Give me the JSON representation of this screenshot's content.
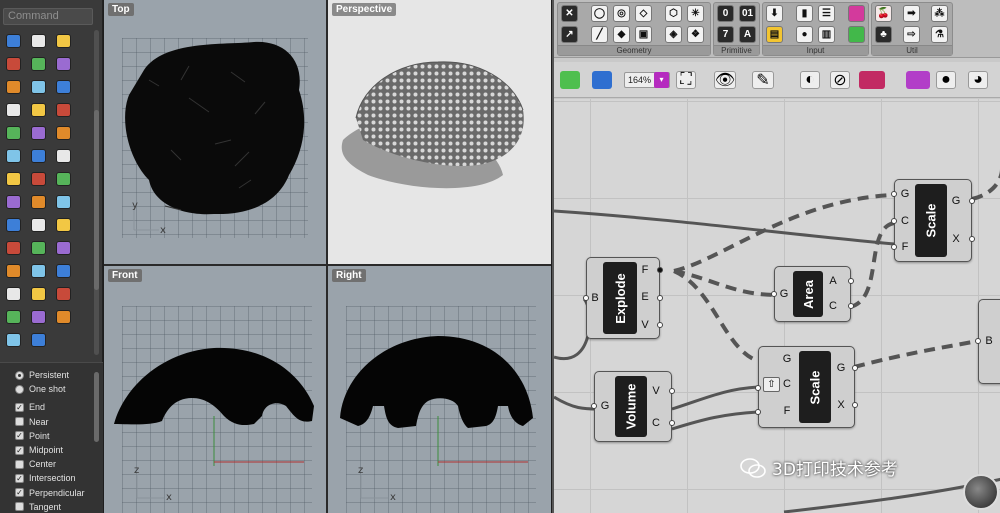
{
  "rhino": {
    "command_placeholder": "Command",
    "tools": [
      "box-icon",
      "sphere-icon",
      "cylinder-icon",
      "plane-icon",
      "move-icon",
      "curve-icon",
      "sweep-icon",
      "polyline-icon",
      "point-icon",
      "align-icon",
      "rotate-icon",
      "arc-icon",
      "text-icon",
      "scale-icon",
      "array-icon",
      "mirror-icon",
      "box3d-icon",
      "hatch-icon",
      "grid-icon",
      "split-icon",
      "paint-icon",
      "check-icon",
      "eraser-icon",
      "bucket-icon",
      "zoom-icon",
      "zoom-window-icon",
      "zoom-extents-icon",
      "zoom-in-icon",
      "zoom-out-icon",
      "measure-icon",
      "layer-icon",
      "shade-icon",
      "light-icon",
      "lock-icon",
      "render-icon",
      "color-wheel-icon",
      "globe-icon",
      "wire-sphere-icon",
      "viewport-icon",
      "pen-icon",
      "snap-tree-icon"
    ],
    "snap": {
      "persistent": "Persistent",
      "one_shot": "One shot",
      "items": [
        {
          "label": "End",
          "checked": true
        },
        {
          "label": "Near",
          "checked": false
        },
        {
          "label": "Point",
          "checked": true
        },
        {
          "label": "Midpoint",
          "checked": true
        },
        {
          "label": "Center",
          "checked": false
        },
        {
          "label": "Intersection",
          "checked": true
        },
        {
          "label": "Perpendicular",
          "checked": true
        },
        {
          "label": "Tangent",
          "checked": false
        }
      ]
    },
    "viewports": {
      "top": "Top",
      "perspective": "Perspective",
      "front": "Front",
      "right": "Right",
      "axes": {
        "x": "x",
        "y": "y",
        "z": "z"
      }
    }
  },
  "grasshopper": {
    "ribbon": {
      "geometry": "Geometry",
      "primitive": "Primitive",
      "input": "Input",
      "util": "Util",
      "primitive_icons": [
        "0",
        "01",
        "7",
        "A"
      ]
    },
    "toolbar": {
      "zoom": "164%"
    },
    "components": {
      "explode": {
        "name": "Explode",
        "inputs": [
          "B"
        ],
        "outputs": [
          "F",
          "E",
          "V"
        ]
      },
      "area": {
        "name": "Area",
        "inputs": [
          "G"
        ],
        "outputs": [
          "A",
          "C"
        ]
      },
      "scale_top": {
        "name": "Scale",
        "inputs": [
          "G",
          "C",
          "F"
        ],
        "outputs": [
          "G",
          "X"
        ]
      },
      "scale_mid": {
        "name": "Scale",
        "inputs": [
          "G",
          "C",
          "F"
        ],
        "outputs": [
          "G",
          "X"
        ]
      },
      "volume": {
        "name": "Volume",
        "inputs": [
          "G"
        ],
        "outputs": [
          "V",
          "C"
        ]
      },
      "partial_input": "B"
    },
    "watermark": "3D打印技术参考"
  }
}
